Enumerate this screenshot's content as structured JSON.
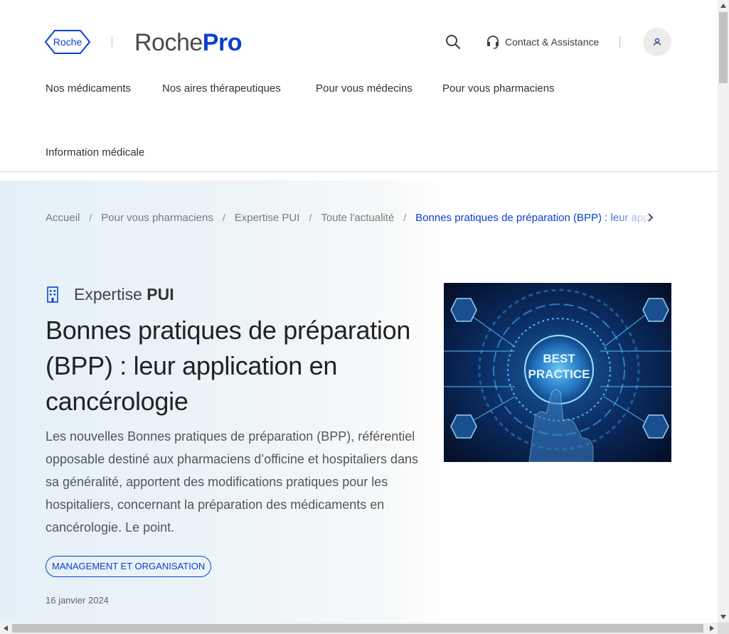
{
  "header": {
    "brand_small": "Roche",
    "brand_word": "Roche",
    "brand_pro": "Pro",
    "contact_label": "Contact & Assistance",
    "icons": [
      "search-icon",
      "headset-icon",
      "user-icon"
    ],
    "accent_color": "#0b41cd"
  },
  "nav": {
    "items": [
      "Nos médicaments",
      "Nos aires thérapeutiques",
      "Pour vous médecins",
      "Pour vous pharmaciens",
      "Information médicale"
    ]
  },
  "breadcrumb": {
    "items": [
      "Accueil",
      "Pour vous pharmaciens",
      "Expertise PUI",
      "Toute l'actualité"
    ],
    "current": "Bonnes pratiques de préparation (BPP) : leur application en cancérologie",
    "separator": "/"
  },
  "article": {
    "category_prefix": "Expertise",
    "category_strong": "PUI",
    "title": "Bonnes pratiques de préparation (BPP) : leur application en cancérologie",
    "lead": "Les nouvelles Bonnes pratiques de préparation (BPP), référentiel opposable destiné aux pharmaciens d’officine et hospitaliers dans sa généralité, apportent des modifications pratiques pour les hospitaliers, concernant la préparation des médicaments en cancérologie. Le point.",
    "tag": "MANAGEMENT ET ORGANISATION",
    "date": "16 janvier 2024",
    "image_text_1": "BEST",
    "image_text_2": "PRACTICE"
  }
}
